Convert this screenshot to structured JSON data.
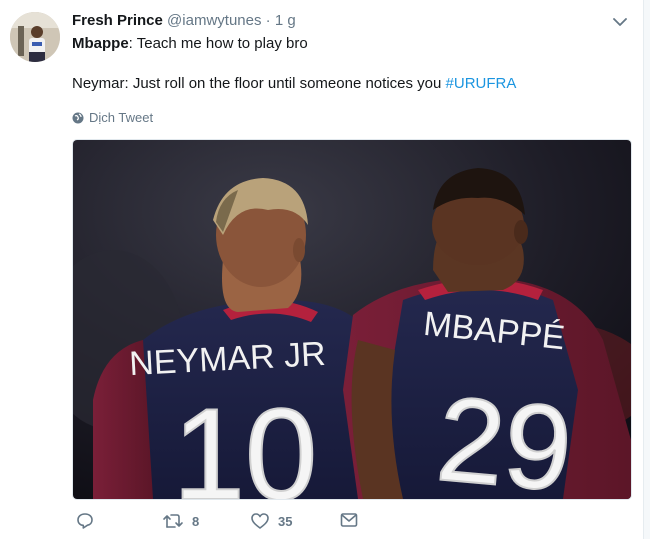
{
  "tweet": {
    "fullname": "Fresh Prince",
    "username": "@iamwytunes",
    "separator": "·",
    "time": "1 g",
    "line1_speaker": "Mbappe",
    "line1_text": ": Teach me how to play bro",
    "line2_text": "Neymar: Just roll on the floor until someone notices you ",
    "hashtag": "#URUFRA",
    "translate_label": "Dịch Tweet"
  },
  "media": {
    "left_jersey_name": "NEYMAR JR",
    "left_jersey_number": "10",
    "right_jersey_name": "MBAPPÉ",
    "right_jersey_number": "29"
  },
  "actions": {
    "reply_count": "",
    "retweet_count": "8",
    "like_count": "35"
  },
  "icons": {
    "caret": "chevron-down-icon",
    "translate": "globe-icon",
    "reply": "reply-icon",
    "retweet": "retweet-icon",
    "like": "heart-icon",
    "message": "envelope-icon"
  },
  "colors": {
    "link": "#1b95e0",
    "muted": "#657786",
    "text": "#14171a"
  }
}
